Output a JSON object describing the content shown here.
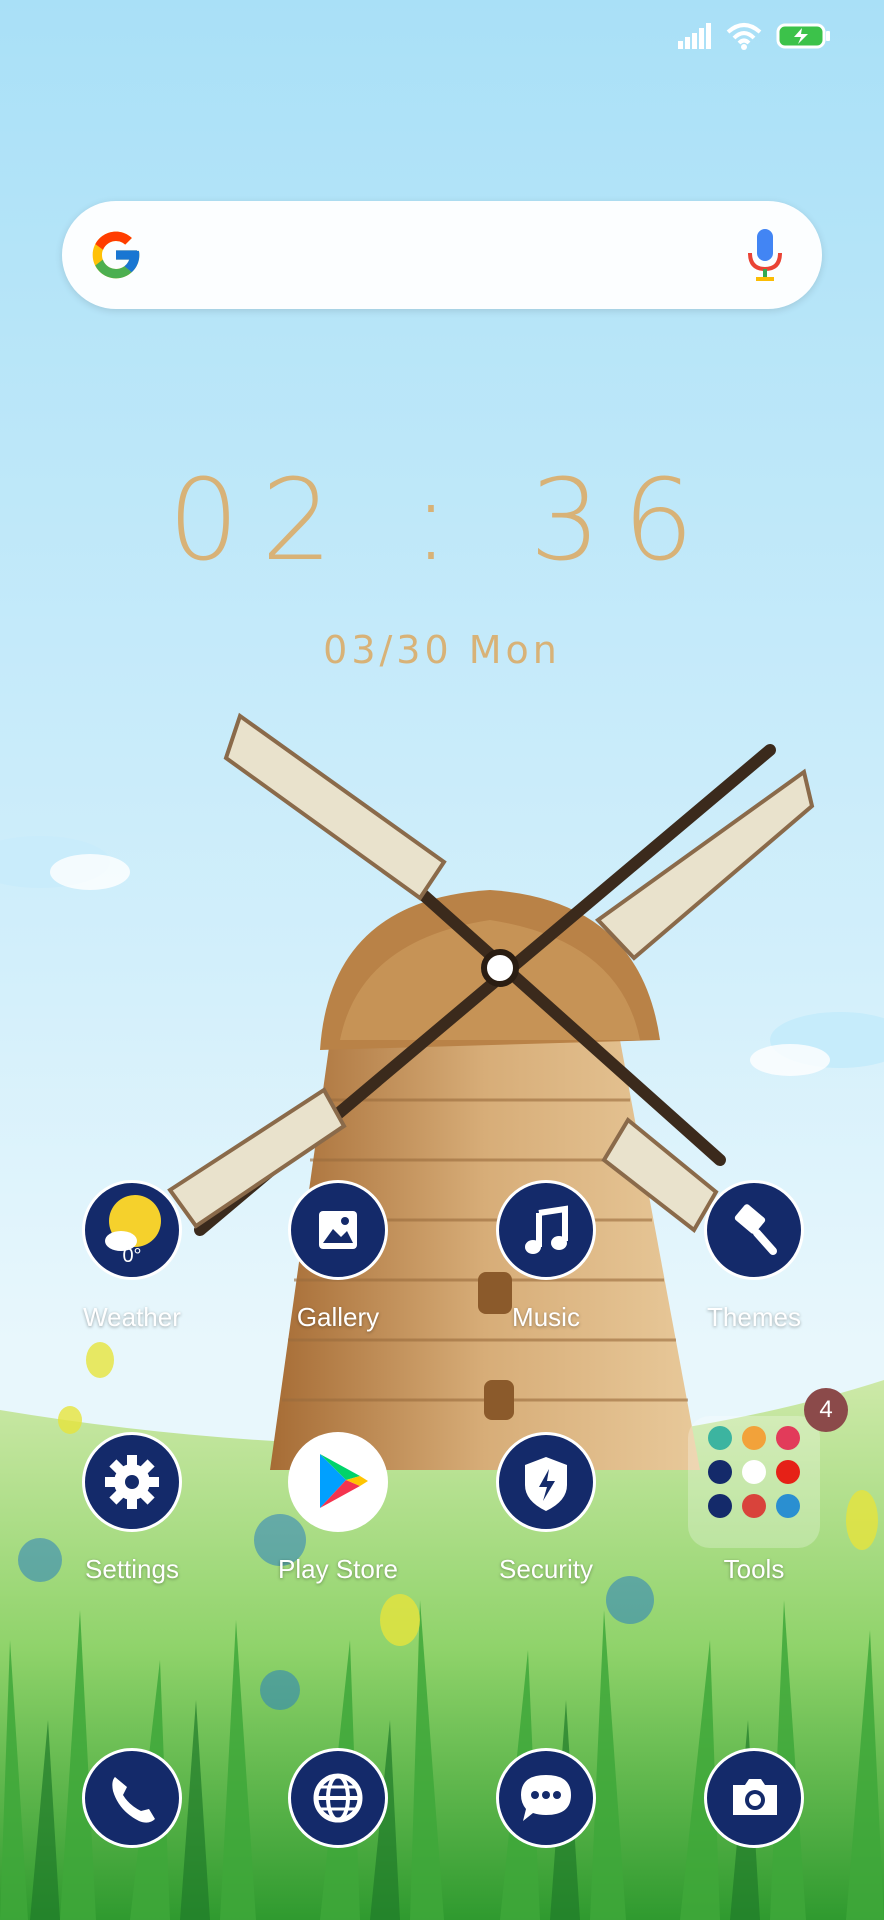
{
  "status": {
    "signal": "signal-icon",
    "wifi": "wifi-icon",
    "battery": "battery-charging-icon",
    "battery_color": "#3cc24a"
  },
  "search": {
    "logo": "google-g-icon",
    "mic": "microphone-icon"
  },
  "clock": {
    "time": "02 : 36",
    "date": "03/30 Mon"
  },
  "weather": {
    "temp": "0°"
  },
  "apps_row1": [
    {
      "label": "Weather",
      "icon": "weather-icon"
    },
    {
      "label": "Gallery",
      "icon": "gallery-icon"
    },
    {
      "label": "Music",
      "icon": "music-icon"
    },
    {
      "label": "Themes",
      "icon": "themes-brush-icon"
    }
  ],
  "apps_row2": [
    {
      "label": "Settings",
      "icon": "gear-icon"
    },
    {
      "label": "Play Store",
      "icon": "play-store-icon"
    },
    {
      "label": "Security",
      "icon": "shield-icon"
    },
    {
      "label": "Tools",
      "icon": "folder-icon",
      "badge": "4"
    }
  ],
  "dock": [
    {
      "icon": "phone-icon"
    },
    {
      "icon": "browser-globe-icon"
    },
    {
      "icon": "messages-icon"
    },
    {
      "icon": "camera-icon"
    }
  ],
  "colors": {
    "icon_navy": "#142a6a",
    "clock": "#d8b277",
    "sky_top": "#a9dff6",
    "grass": "#4caf32"
  }
}
